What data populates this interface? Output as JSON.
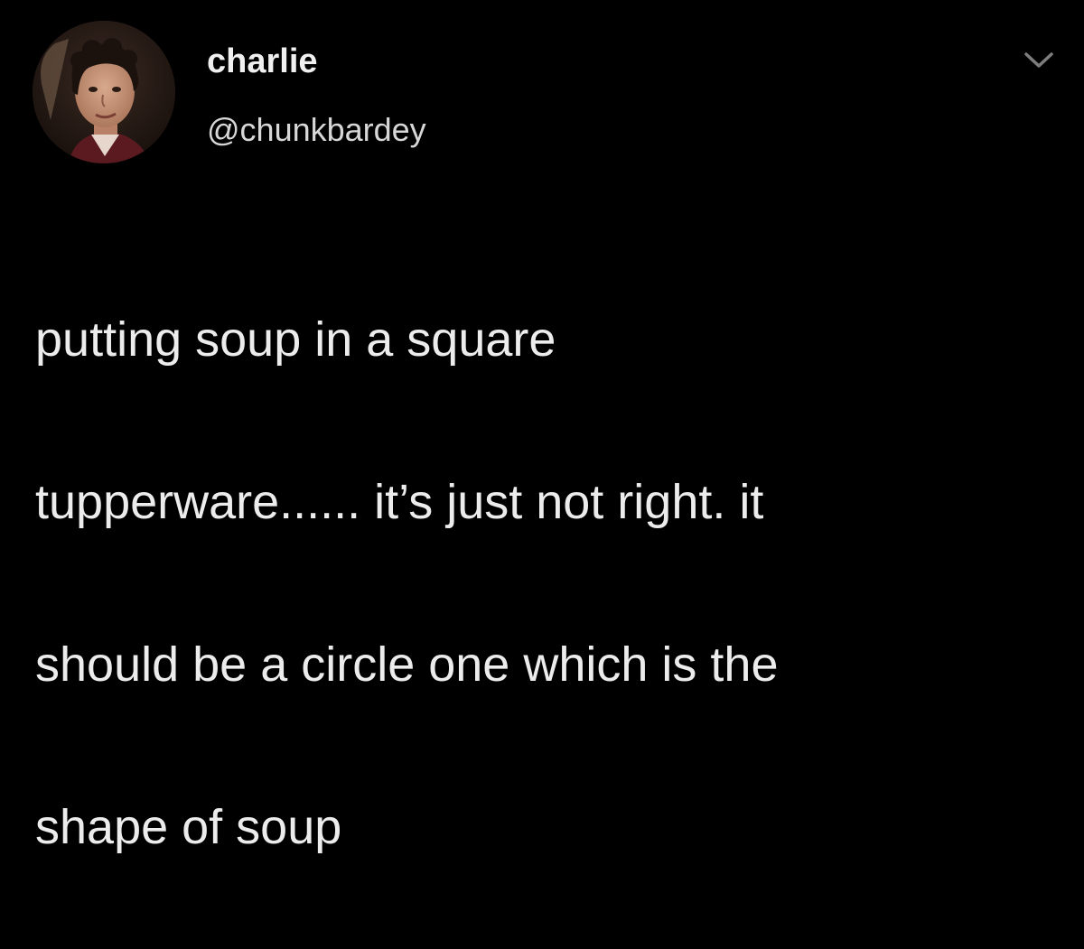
{
  "tweet": {
    "author": {
      "display_name": "charlie",
      "handle": "@chunkbardey",
      "avatar": "profile-photo"
    },
    "menu_icon": "chevron-down-icon",
    "text_lines": [
      "putting soup in a square",
      "tupperware...... it’s just not right. it",
      "should be a circle one which is the",
      "shape of soup"
    ]
  },
  "colors": {
    "background": "#000000",
    "text": "#ececec",
    "muted": "#8a8a8a"
  }
}
